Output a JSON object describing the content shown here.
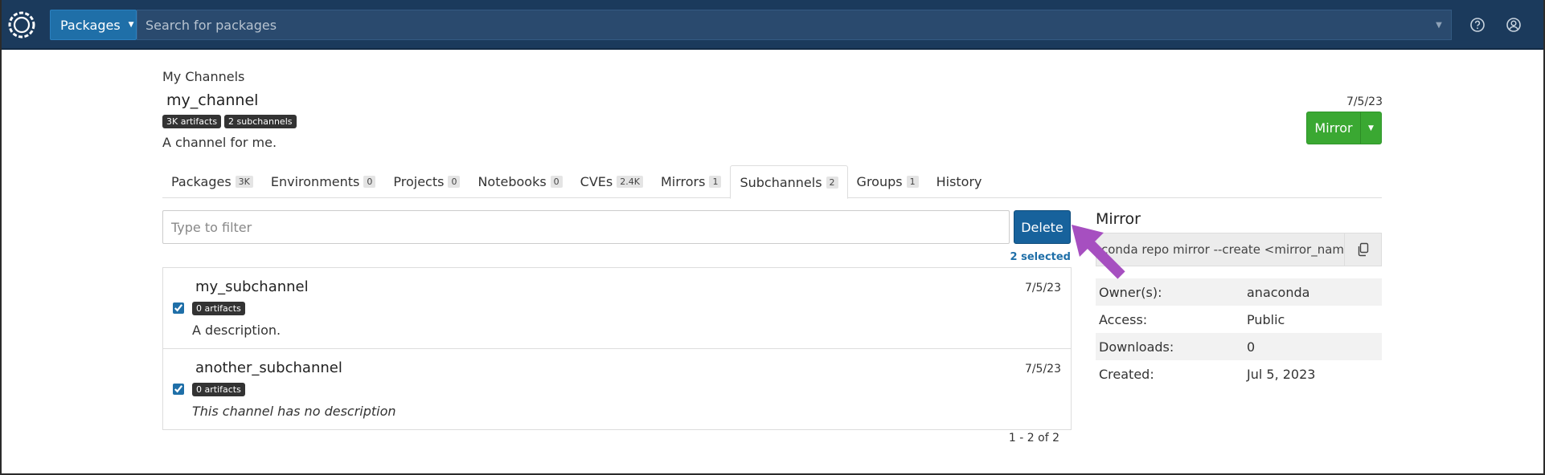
{
  "navbar": {
    "packages_label": "Packages",
    "search_placeholder": "Search for packages"
  },
  "header": {
    "breadcrumb": "My Channels",
    "channel_name": "my_channel",
    "badges": [
      "3K artifacts",
      "2 subchannels"
    ],
    "description": "A channel for me.",
    "date": "7/5/23",
    "mirror_button": "Mirror"
  },
  "tabs": [
    {
      "label": "Packages",
      "count": "3K"
    },
    {
      "label": "Environments",
      "count": "0"
    },
    {
      "label": "Projects",
      "count": "0"
    },
    {
      "label": "Notebooks",
      "count": "0"
    },
    {
      "label": "CVEs",
      "count": "2.4K"
    },
    {
      "label": "Mirrors",
      "count": "1"
    },
    {
      "label": "Subchannels",
      "count": "2"
    },
    {
      "label": "Groups",
      "count": "1"
    },
    {
      "label": "History",
      "count": ""
    }
  ],
  "active_tab": "Subchannels",
  "filter": {
    "placeholder": "Type to filter",
    "value": ""
  },
  "delete_button": "Delete",
  "selected_text": "2 selected",
  "subchannels": [
    {
      "name": "my_subchannel",
      "date": "7/5/23",
      "artifacts": "0 artifacts",
      "description": "A description.",
      "checked": true
    },
    {
      "name": "another_subchannel",
      "date": "7/5/23",
      "artifacts": "0 artifacts",
      "description": "This channel has no description",
      "checked": true
    }
  ],
  "pagination": "1 - 2 of 2",
  "side_panel": {
    "heading": "Mirror",
    "command": "conda repo mirror --create <mirror_name",
    "meta": [
      {
        "key": "Owner(s):",
        "value": "anaconda"
      },
      {
        "key": "Access:",
        "value": "Public"
      },
      {
        "key": "Downloads:",
        "value": "0"
      },
      {
        "key": "Created:",
        "value": "Jul 5, 2023"
      }
    ]
  },
  "colors": {
    "navbar": "#1b3a5c",
    "primary": "#17629c",
    "mirror_green": "#3aa832",
    "annotation_arrow": "#a64fc0"
  }
}
